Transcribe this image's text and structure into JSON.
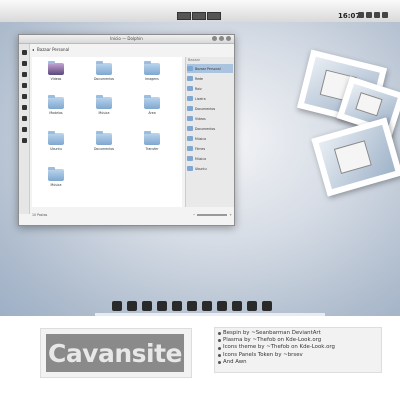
{
  "top_panel": {
    "clock": "16:07"
  },
  "window": {
    "title": "Inicio — Dolphin",
    "breadcrumb": [
      "Bazaar Personal"
    ],
    "files": [
      {
        "label": "Vídeos"
      },
      {
        "label": "Documentos"
      },
      {
        "label": "Imagens"
      },
      {
        "label": "Modelos"
      },
      {
        "label": "Música"
      },
      {
        "label": "Área"
      },
      {
        "label": "Ubuntu"
      },
      {
        "label": "Documentos"
      },
      {
        "label": "Transfer"
      },
      {
        "label": "Música"
      }
    ],
    "places_header": "Bazaar",
    "places": [
      {
        "label": "Bazaar Personal"
      },
      {
        "label": "Rede"
      },
      {
        "label": "Raiz"
      },
      {
        "label": "Lixeira"
      },
      {
        "label": "Documentos"
      },
      {
        "label": "Vídeos"
      },
      {
        "label": "Documentos"
      },
      {
        "label": "Música"
      },
      {
        "label": "Filmes"
      },
      {
        "label": "Música"
      },
      {
        "label": "Ubuntu"
      }
    ],
    "status": "10 Pastas",
    "free_space": ""
  },
  "bottom": {
    "logo": "Cavansite",
    "credits": [
      "Bespin by ~Seanbarman DeviantArt",
      "Plasma by ~Thefob on Kde-Look.org",
      "Icons theme by ~Thefob on Kde-Look.org",
      "Icons Panels Token by ~brsev",
      "And Awn"
    ]
  },
  "icons": {
    "dock": [
      "app-icon",
      "rss-icon",
      "mail-icon",
      "terminal-icon",
      "tweet-icon",
      "swirl-icon",
      "music-icon",
      "text-icon",
      "list-icon",
      "feather-icon",
      "folder-icon"
    ]
  }
}
